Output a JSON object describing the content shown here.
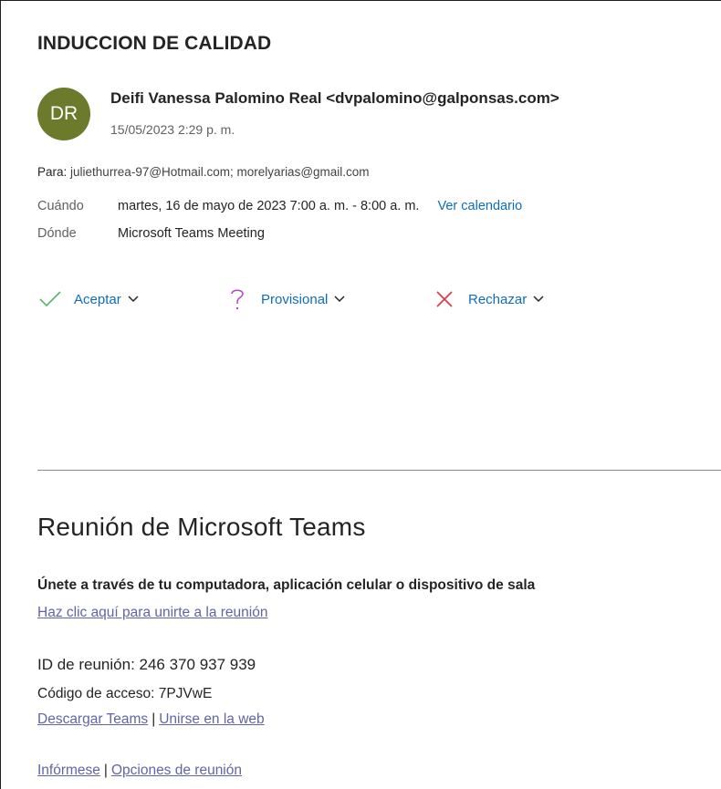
{
  "subject": "INDUCCION DE CALIDAD",
  "sender": {
    "initials": "DR",
    "avatar_color": "#6c7a2b",
    "name_email": "Deifi Vanessa Palomino Real <dvpalomino@galponsas.com>",
    "date": "15/05/2023 2:29 p. m."
  },
  "to": {
    "label": "Para:",
    "recipients": " juliethurrea-97@Hotmail.com; morelyarias@gmail.com"
  },
  "when": {
    "label": "Cuándo",
    "value": "martes, 16 de mayo de 2023 7:00 a. m. - 8:00 a. m.",
    "calendar_link": "Ver calendario"
  },
  "where": {
    "label": "Dónde",
    "value": "Microsoft Teams Meeting"
  },
  "actions": {
    "accept": "Aceptar",
    "tentative": "Provisional",
    "decline": "Rechazar",
    "accept_color": "#5bb36a",
    "tentative_color": "#b146c2",
    "decline_color": "#e4343f"
  },
  "body": {
    "title": "Reunión de Microsoft Teams",
    "join_heading": "Únete a través de tu computadora, aplicación celular o dispositivo de sala",
    "join_link": "Haz clic aquí para unirte a la reunión",
    "meeting_id_label": "ID de reunión: ",
    "meeting_id": "246 370 937 939",
    "passcode_label": "Código de acceso: ",
    "passcode": "7PJVwE",
    "download_link": "Descargar Teams",
    "web_link": "Unirse en la web",
    "separator": "|",
    "learn_more_link": "Infórmese",
    "options_link": "Opciones de reunión"
  }
}
